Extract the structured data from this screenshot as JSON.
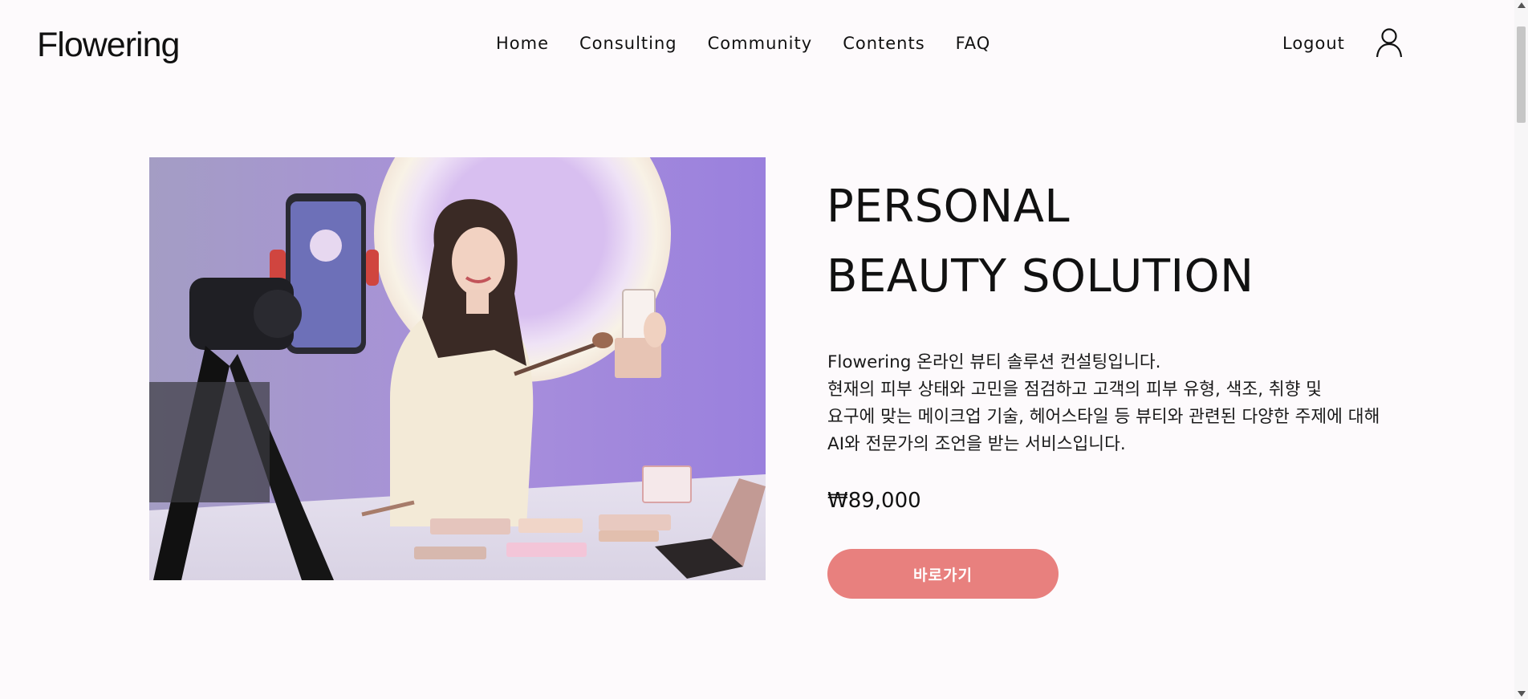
{
  "header": {
    "logo": "Flowering",
    "nav": [
      "Home",
      "Consulting",
      "Community",
      "Contents",
      "FAQ"
    ],
    "logout": "Logout",
    "user_icon": "user-icon"
  },
  "hero": {
    "image_icon": "photo-makeup-creator",
    "title_line1": "PERSONAL",
    "title_line2": "BEAUTY SOLUTION",
    "description": [
      "Flowering 온라인 뷰티 솔루션 컨설팅입니다.",
      "현재의 피부 상태와 고민을 점검하고 고객의 피부 유형, 색조, 취향 및",
      "요구에 맞는 메이크업 기술, 헤어스타일 등 뷰티와 관련된 다양한 주제에 대해",
      "AI와 전문가의 조언을 받는 서비스입니다."
    ],
    "price": "₩89,000",
    "cta_label": "바로가기"
  },
  "colors": {
    "background": "#fdfafc",
    "accent": "#e8807e",
    "text": "#111111"
  }
}
